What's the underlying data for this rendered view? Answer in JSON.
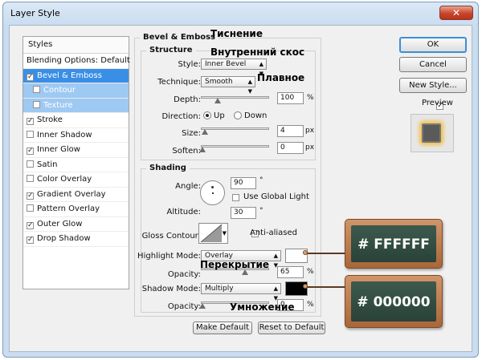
{
  "window": {
    "title": "Layer Style",
    "close_icon": "close-icon (×)"
  },
  "styles_panel": {
    "header": "Styles",
    "items": [
      {
        "label": "Blending Options: Default",
        "checkbox": false,
        "checked": false,
        "selected": false
      },
      {
        "label": "Bevel & Emboss",
        "checkbox": true,
        "checked": true,
        "selected": true
      },
      {
        "label": "Contour",
        "checkbox": true,
        "checked": false,
        "sub": true
      },
      {
        "label": "Texture",
        "checkbox": true,
        "checked": false,
        "sub": true
      },
      {
        "label": "Stroke",
        "checkbox": true,
        "checked": true
      },
      {
        "label": "Inner Shadow",
        "checkbox": true,
        "checked": false
      },
      {
        "label": "Inner Glow",
        "checkbox": true,
        "checked": true
      },
      {
        "label": "Satin",
        "checkbox": true,
        "checked": false
      },
      {
        "label": "Color Overlay",
        "checkbox": true,
        "checked": false
      },
      {
        "label": "Gradient Overlay",
        "checkbox": true,
        "checked": true
      },
      {
        "label": "Pattern Overlay",
        "checkbox": true,
        "checked": false
      },
      {
        "label": "Outer Glow",
        "checkbox": true,
        "checked": true
      },
      {
        "label": "Drop Shadow",
        "checkbox": true,
        "checked": true
      }
    ]
  },
  "bevel": {
    "group_title": "Bevel & Emboss",
    "structure_title": "Structure",
    "style_label": "Style:",
    "style_value": "Inner Bevel",
    "technique_label": "Technique:",
    "technique_value": "Smooth",
    "depth_label": "Depth:",
    "depth_value": "100",
    "depth_unit": "%",
    "direction_label": "Direction:",
    "direction_up": "Up",
    "direction_down": "Down",
    "direction_selected": "Up",
    "size_label": "Size:",
    "size_value": "4",
    "size_unit": "px",
    "soften_label": "Soften:",
    "soften_value": "0",
    "soften_unit": "px"
  },
  "shading": {
    "title": "Shading",
    "angle_label": "Angle:",
    "angle_value": "90",
    "angle_unit": "°",
    "global_light_label": "Use Global Light",
    "global_light_checked": false,
    "altitude_label": "Altitude:",
    "altitude_value": "30",
    "altitude_unit": "°",
    "gloss_label": "Gloss Contour:",
    "anti_aliased_label": "Anti-aliased",
    "anti_aliased_checked": false,
    "highlight_mode_label": "Highlight Mode:",
    "highlight_mode_value": "Overlay",
    "highlight_color": "#FFFFFF",
    "highlight_opacity_label": "Opacity:",
    "highlight_opacity_value": "65",
    "highlight_opacity_unit": "%",
    "shadow_mode_label": "Shadow Mode:",
    "shadow_mode_value": "Multiply",
    "shadow_color": "#000000",
    "shadow_opacity_label": "Opacity:",
    "shadow_opacity_value": "0",
    "shadow_opacity_unit": "%"
  },
  "bottom_buttons": {
    "make_default": "Make Default",
    "reset_default": "Reset to Default"
  },
  "right_buttons": {
    "ok": "OK",
    "cancel": "Cancel",
    "new_style": "New Style...",
    "preview_label": "Preview",
    "preview_checked": true
  },
  "annotations": {
    "tisnenie": "Тиснение",
    "vnutrenniy": "Внутренний скос",
    "plavnoe": "Плавное",
    "perekrytie": "Перекрытие",
    "umnozhenie": "Умножение",
    "board_white": "# FFFFFF",
    "board_black": "# 000000"
  },
  "colors": {
    "accent_selected": "#3a8ee6",
    "board_bg": "#2f483e",
    "board_frame": "#b97745"
  }
}
